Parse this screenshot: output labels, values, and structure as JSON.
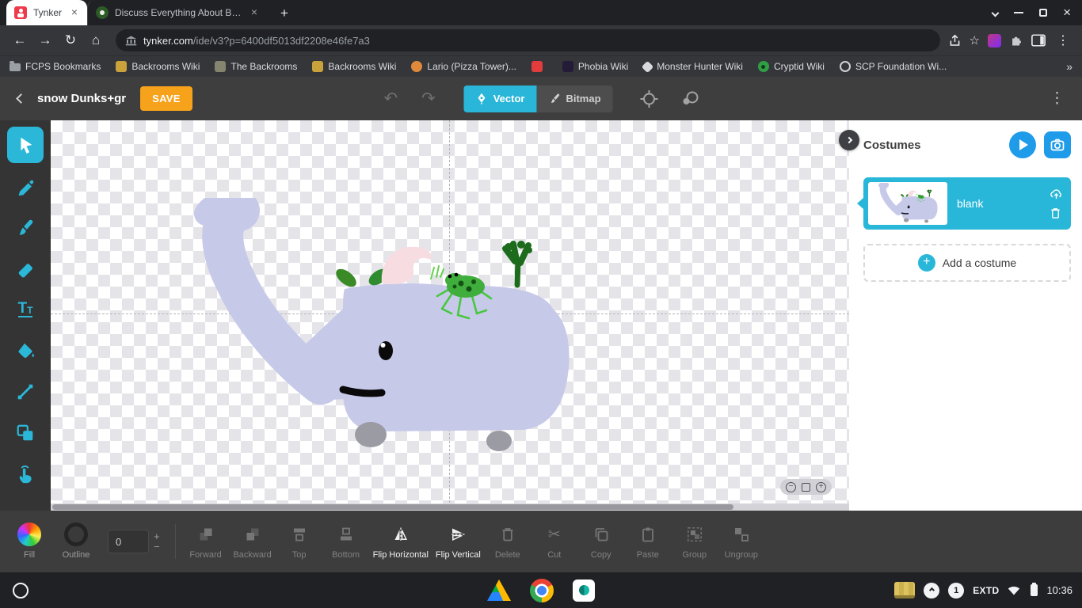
{
  "browser": {
    "tabs": [
      {
        "label": "Tynker"
      },
      {
        "label": "Discuss Everything About Backr"
      }
    ],
    "url": {
      "domain": "tynker.com",
      "path": "/ide/v3?p=6400df5013df2208e46fe7a3"
    },
    "bookmarks": [
      {
        "label": "FCPS Bookmarks"
      },
      {
        "label": "Backrooms Wiki"
      },
      {
        "label": "The Backrooms"
      },
      {
        "label": "Backrooms Wiki"
      },
      {
        "label": "Lario (Pizza Tower)..."
      },
      {
        "label": ""
      },
      {
        "label": "Phobia Wiki"
      },
      {
        "label": "Monster Hunter Wiki"
      },
      {
        "label": "Cryptid Wiki"
      },
      {
        "label": "SCP Foundation Wi..."
      }
    ]
  },
  "editor": {
    "project_title": "snow Dunks+gr",
    "save_label": "SAVE",
    "vector_label": "Vector",
    "bitmap_label": "Bitmap"
  },
  "costumes": {
    "title": "Costumes",
    "items": [
      {
        "name": "blank"
      }
    ],
    "add_label": "Add a costume"
  },
  "bottom_toolbar": {
    "fill_label": "Fill",
    "outline_label": "Outline",
    "stroke_width": "0",
    "buttons": [
      {
        "label": "Forward"
      },
      {
        "label": "Backward"
      },
      {
        "label": "Top"
      },
      {
        "label": "Bottom"
      },
      {
        "label": "Flip Horizontal"
      },
      {
        "label": "Flip Vertical"
      },
      {
        "label": "Delete"
      },
      {
        "label": "Cut"
      },
      {
        "label": "Copy"
      },
      {
        "label": "Paste"
      },
      {
        "label": "Group"
      },
      {
        "label": "Ungroup"
      }
    ]
  },
  "shelf": {
    "display_mode": "EXTD",
    "time": "10:36",
    "notification_count": "1"
  },
  "icons": {
    "back": "←",
    "forward": "→",
    "reload": "↻",
    "home": "⌂",
    "star": "☆",
    "kebab": "⋮",
    "close": "×",
    "plus": "+",
    "minus": "−",
    "undo": "↶",
    "redo": "↷",
    "cut": "✂",
    "overflow": "»",
    "text_tool_large": "T",
    "text_tool_small": "T"
  },
  "colors": {
    "accent_cyan": "#29b6d8",
    "save_orange": "#f7a21b",
    "action_blue": "#1e9be9"
  }
}
